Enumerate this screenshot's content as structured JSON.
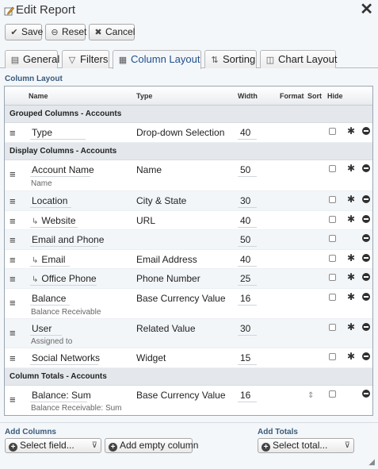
{
  "window": {
    "title": "Edit Report"
  },
  "toolbar": {
    "save_label": "Save",
    "reset_label": "Reset",
    "cancel_label": "Cancel"
  },
  "tabs": [
    {
      "label": "General"
    },
    {
      "label": "Filters"
    },
    {
      "label": "Column Layout"
    },
    {
      "label": "Sorting"
    },
    {
      "label": "Chart Layout"
    }
  ],
  "active_tab": "Column Layout",
  "section_title": "Column Layout",
  "columns_header": {
    "name": "Name",
    "type": "Type",
    "width": "Width",
    "format": "Format",
    "sort": "Sort",
    "hide": "Hide"
  },
  "groups": [
    {
      "title": "Grouped Columns - Accounts"
    },
    {
      "title": "Display Columns - Accounts"
    },
    {
      "title": "Column Totals - Accounts"
    }
  ],
  "rows": [
    {
      "name": "Type",
      "sub": "",
      "type": "Drop-down Selection",
      "width": "40"
    },
    {
      "name": "Account Name",
      "sub": "Name",
      "type": "Name",
      "width": "50"
    },
    {
      "name": "Location",
      "sub": "",
      "type": "City & State",
      "width": "30"
    },
    {
      "name": "Website",
      "sub": "",
      "type": "URL",
      "width": "40"
    },
    {
      "name": "Email and Phone",
      "sub": "",
      "type": "",
      "width": "50"
    },
    {
      "name": "Email",
      "sub": "",
      "type": "Email Address",
      "width": "40"
    },
    {
      "name": "Office Phone",
      "sub": "",
      "type": "Phone Number",
      "width": "25"
    },
    {
      "name": "Balance",
      "sub": "Balance Receivable",
      "type": "Base Currency Value",
      "width": "16"
    },
    {
      "name": "User",
      "sub": "Assigned to",
      "type": "Related Value",
      "width": "30"
    },
    {
      "name": "Social Networks",
      "sub": "",
      "type": "Widget",
      "width": "15"
    },
    {
      "name": "Balance: Sum",
      "sub": "Balance Receivable: Sum",
      "type": "Base Currency Value",
      "width": "16"
    }
  ],
  "bottom": {
    "add_columns_label": "Add Columns",
    "select_field": "Select field...",
    "add_empty_column": "Add empty column",
    "add_totals_label": "Add Totals",
    "select_total": "Select total..."
  },
  "colors": {
    "accent": "#1f4e8c",
    "group_bg": "#e4e8ec",
    "alt_row": "#f3f6f9"
  },
  "icons": [
    "pencil-icon",
    "close-icon",
    "check-icon",
    "reset-icon",
    "cancel-icon",
    "general-icon",
    "filter-icon",
    "layout-icon",
    "sort-icon",
    "chart-icon",
    "drag-handle-icon",
    "indent-arrow-icon",
    "gear-icon",
    "remove-icon",
    "sort-arrows-icon",
    "plus-icon",
    "chevron-down-icon",
    "resize-grip-icon"
  ]
}
